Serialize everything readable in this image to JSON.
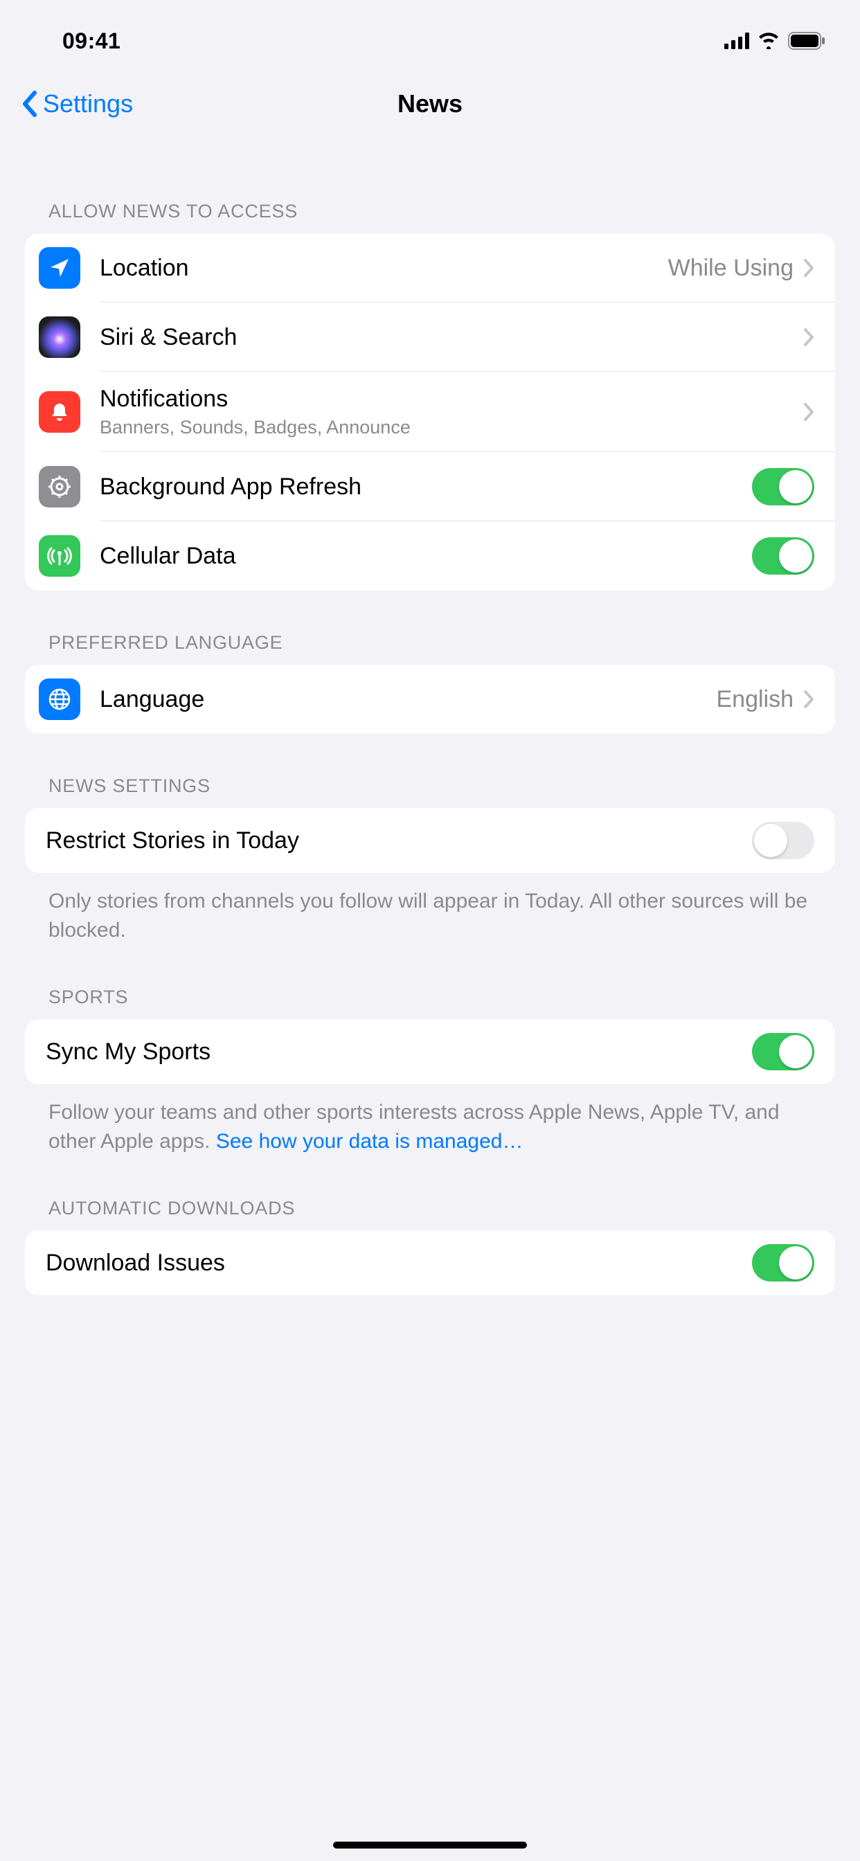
{
  "status": {
    "time": "09:41"
  },
  "nav": {
    "back": "Settings",
    "title": "News"
  },
  "sections": {
    "access": {
      "header": "ALLOW NEWS TO ACCESS",
      "location": {
        "label": "Location",
        "value": "While Using"
      },
      "siri": {
        "label": "Siri & Search"
      },
      "notifications": {
        "label": "Notifications",
        "sub": "Banners, Sounds, Badges, Announce"
      },
      "refresh": {
        "label": "Background App Refresh",
        "on": true
      },
      "cellular": {
        "label": "Cellular Data",
        "on": true
      }
    },
    "language": {
      "header": "PREFERRED LANGUAGE",
      "row": {
        "label": "Language",
        "value": "English"
      }
    },
    "news": {
      "header": "NEWS SETTINGS",
      "restrict": {
        "label": "Restrict Stories in Today",
        "on": false
      },
      "footer": "Only stories from channels you follow will appear in Today. All other sources will be blocked."
    },
    "sports": {
      "header": "SPORTS",
      "sync": {
        "label": "Sync My Sports",
        "on": true
      },
      "footer_pre": "Follow your teams and other sports interests across Apple News, Apple TV, and other Apple apps. ",
      "footer_link": "See how your data is managed…"
    },
    "auto": {
      "header": "AUTOMATIC DOWNLOADS",
      "download": {
        "label": "Download Issues",
        "on": true
      }
    }
  }
}
